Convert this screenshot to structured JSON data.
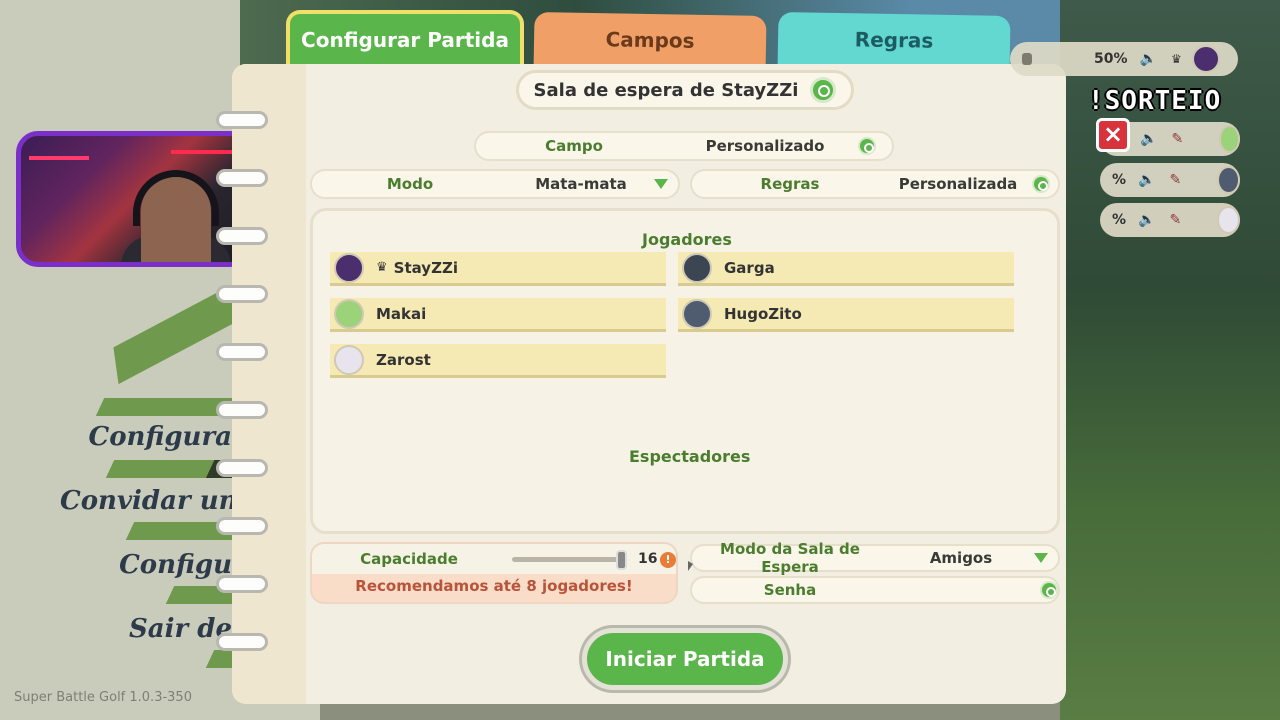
{
  "tabs": {
    "configure": "Configurar Partida",
    "fields": "Campos",
    "rules": "Regras"
  },
  "lobby_title": "Sala de espera de StayZZi",
  "settings": {
    "field_label": "Campo",
    "field_value": "Personalizado",
    "mode_label": "Modo",
    "mode_value": "Mata-mata",
    "rules_label": "Regras",
    "rules_value": "Personalizada"
  },
  "players_title": "Jogadores",
  "players": [
    {
      "name": "StayZZi",
      "host": true,
      "avatar_color": "#4a2e6e"
    },
    {
      "name": "Garga",
      "host": false,
      "avatar_color": "#3c4552"
    },
    {
      "name": "Makai",
      "host": false,
      "avatar_color": "#9bd27a"
    },
    {
      "name": "HugoZito",
      "host": false,
      "avatar_color": "#4f5b6e"
    },
    {
      "name": "Zarost",
      "host": false,
      "avatar_color": "#e8e4ee"
    }
  ],
  "crown_icon": "♛",
  "spectators_title": "Espectadores",
  "capacity": {
    "label": "Capacidade",
    "value": "16",
    "slider_fraction": 0.98,
    "warning": "Recomendamos até 8 jogadores!"
  },
  "lobby_mode": {
    "label": "Modo da Sala de Espera",
    "value": "Amigos"
  },
  "password_label": "Senha",
  "start_button": "Iniciar Partida",
  "menu": {
    "item1": "Configura",
    "item2": "Convidar un",
    "item3": "Configu",
    "item4": "Sair de"
  },
  "version": "Super Battle Golf 1.0.3-350",
  "overlay": {
    "volume_percent": "50%",
    "row_percent": "%",
    "sorteio": "!SORTEIO"
  },
  "colors": {
    "accent_green": "#5ab54a",
    "label_green": "#4b7d2e",
    "tab_fields": "#f0a066",
    "tab_rules": "#62d8d0"
  }
}
